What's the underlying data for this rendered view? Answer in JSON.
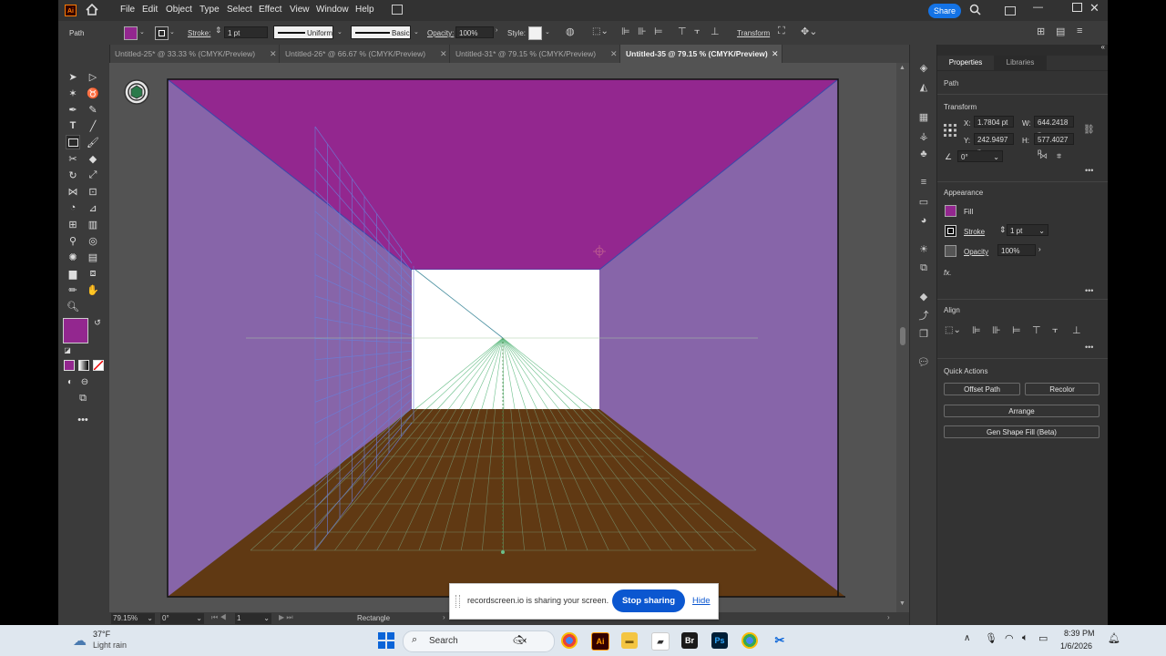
{
  "menubar": {
    "app_icon": "Ai",
    "items": [
      "File",
      "Edit",
      "Object",
      "Type",
      "Select",
      "Effect",
      "View",
      "Window",
      "Help"
    ],
    "share_label": "Share"
  },
  "control_bar": {
    "object_type": "Path",
    "fill_color": "#93278f",
    "stroke_label": "Stroke:",
    "stroke_weight": "1 pt",
    "profile_label": "Uniform",
    "brush_label": "Basic",
    "opacity_label": "Opacity:",
    "opacity_value": "100%",
    "style_label": "Style:",
    "transform_label": "Transform"
  },
  "tabs": [
    {
      "label": "Untitled-25* @ 33.33 % (CMYK/Preview)",
      "active": false
    },
    {
      "label": "Untitled-26* @ 66.67 % (CMYK/Preview)",
      "active": false
    },
    {
      "label": "Untitled-31* @ 79.15 % (CMYK/Preview)",
      "active": false
    },
    {
      "label": "Untitled-35 @ 79.15 % (CMYK/Preview)",
      "active": true
    }
  ],
  "colors": {
    "ceiling": "#93278f",
    "walls": "#8765a9",
    "floor": "#603913",
    "back_wall": "#ffffff",
    "grid": "#6a7fd9",
    "accent": "#1473e6"
  },
  "properties_panel": {
    "tab_properties": "Properties",
    "tab_libraries": "Libraries",
    "object_type": "Path",
    "transform_title": "Transform",
    "x_label": "X:",
    "x_value": "1.7804 pt",
    "y_label": "Y:",
    "y_value": "242.9497 p",
    "w_label": "W:",
    "w_value": "644.2418 p",
    "h_label": "H:",
    "h_value": "577.4027 p",
    "angle_value": "0°",
    "appearance_title": "Appearance",
    "fill_label": "Fill",
    "stroke_label": "Stroke",
    "stroke_value": "1 pt",
    "opacity_label": "Opacity",
    "opacity_value": "100%",
    "fx_label": "fx.",
    "align_title": "Align",
    "quick_actions_title": "Quick Actions",
    "offset_path": "Offset Path",
    "recolor": "Recolor",
    "arrange": "Arrange",
    "gen_shape_fill": "Gen Shape Fill (Beta)"
  },
  "status_bar": {
    "zoom": "79.15%",
    "rotation": "0°",
    "artboard": "1",
    "tool": "Rectangle"
  },
  "share_notification": {
    "message": "recordscreen.io is sharing your screen.",
    "stop_button": "Stop sharing",
    "hide_link": "Hide"
  },
  "taskbar": {
    "temperature": "37°F",
    "weather": "Light rain",
    "search_placeholder": "Search",
    "time": "8:39 PM",
    "date": "1/6/2026"
  }
}
